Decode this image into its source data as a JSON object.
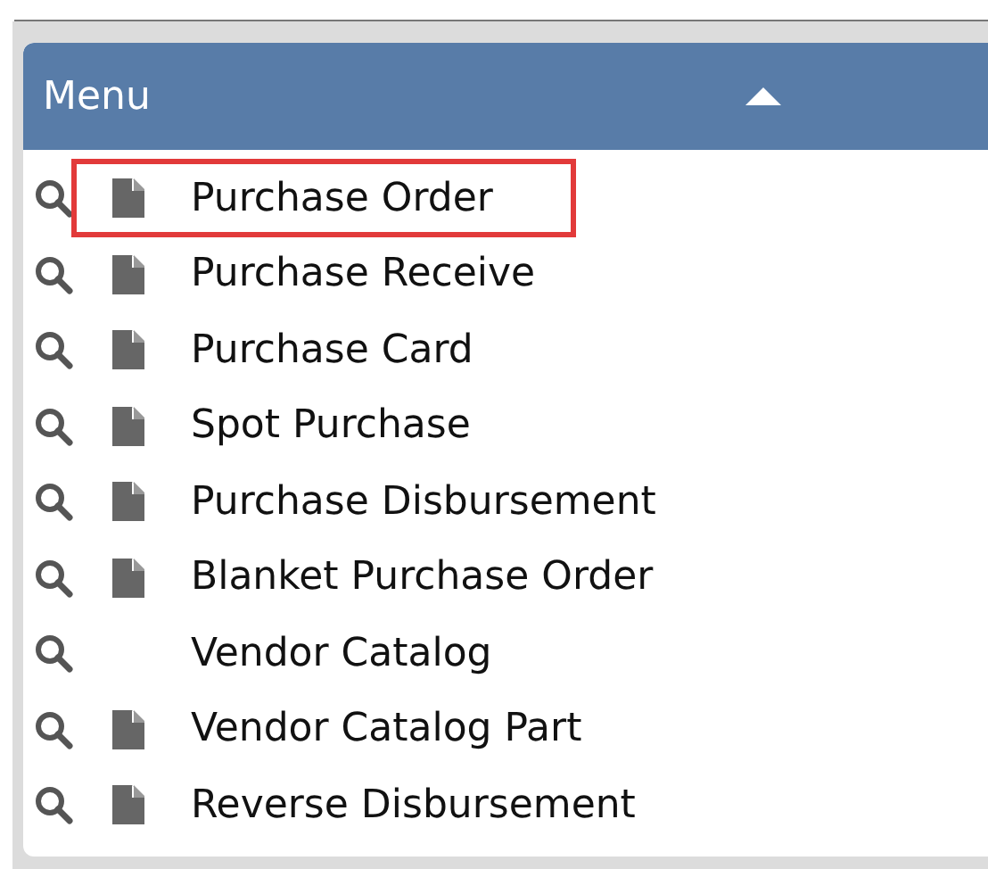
{
  "menu": {
    "title": "Menu",
    "expanded": true,
    "items": [
      {
        "label": "Purchase Order",
        "document_icon": true,
        "highlighted": true
      },
      {
        "label": "Purchase Receive",
        "document_icon": true,
        "highlighted": false
      },
      {
        "label": "Purchase Card",
        "document_icon": true,
        "highlighted": false
      },
      {
        "label": "Spot Purchase",
        "document_icon": true,
        "highlighted": false
      },
      {
        "label": "Purchase Disbursement",
        "document_icon": true,
        "highlighted": false
      },
      {
        "label": "Blanket Purchase Order",
        "document_icon": true,
        "highlighted": false
      },
      {
        "label": "Vendor Catalog",
        "document_icon": false,
        "highlighted": false
      },
      {
        "label": "Vendor Catalog Part",
        "document_icon": true,
        "highlighted": false
      },
      {
        "label": "Reverse Disbursement",
        "document_icon": true,
        "highlighted": false
      }
    ]
  }
}
